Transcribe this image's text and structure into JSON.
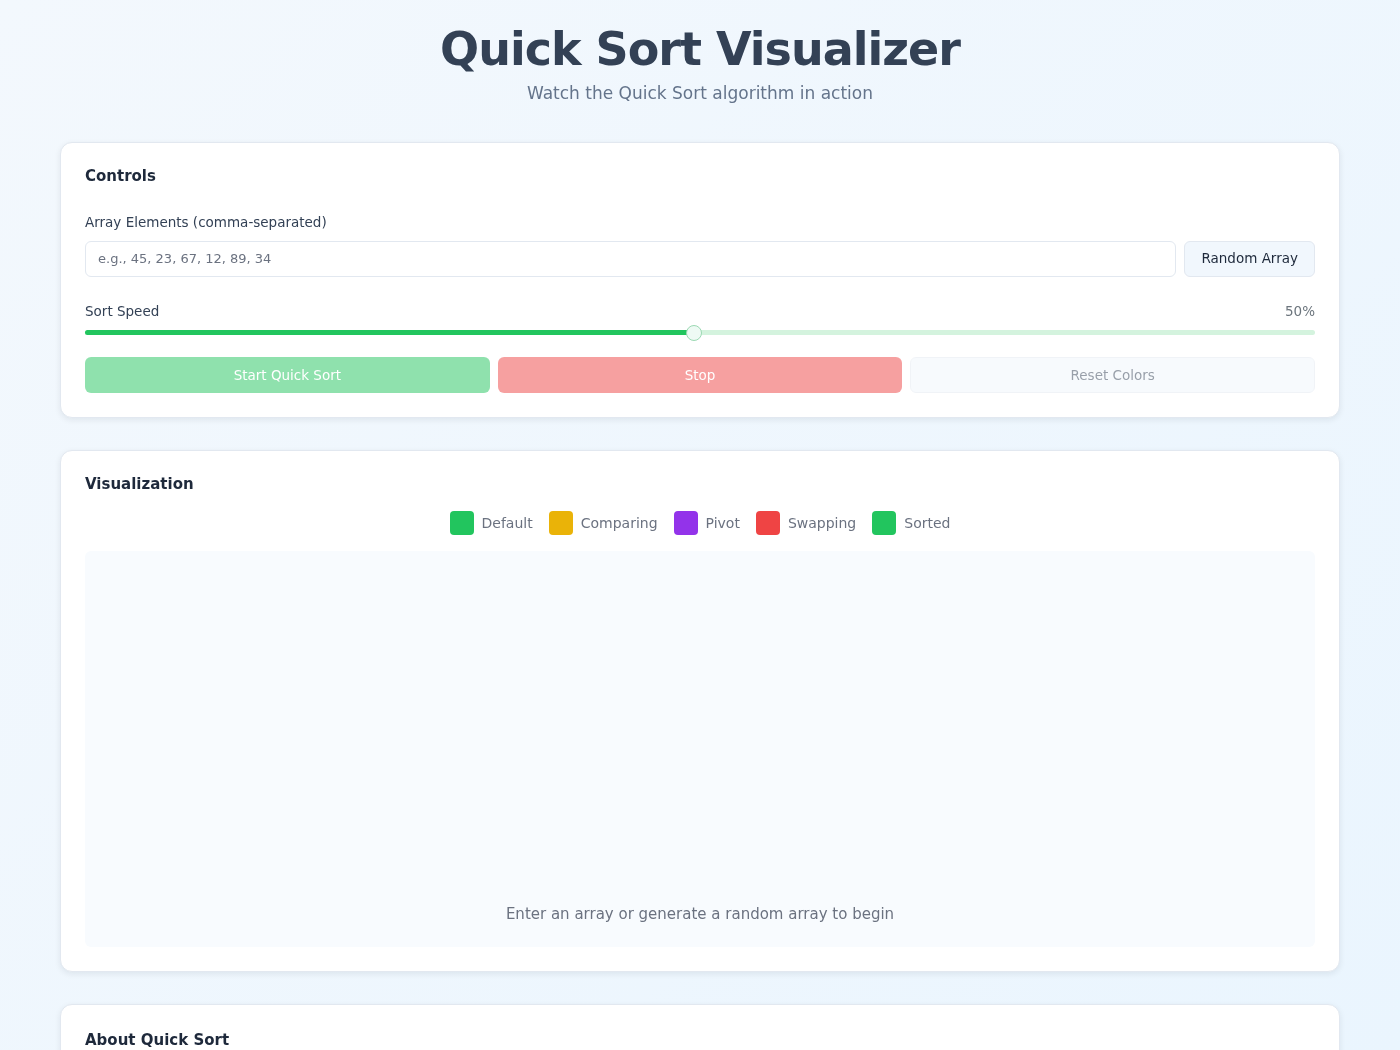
{
  "header": {
    "title": "Quick Sort Visualizer",
    "subtitle": "Watch the Quick Sort algorithm in action"
  },
  "controls": {
    "title": "Controls",
    "array_label": "Array Elements (comma-separated)",
    "array_input": {
      "placeholder": "e.g., 45, 23, 67, 12, 89, 34"
    },
    "random_button": {
      "label": "Random Array",
      "disabled": false
    },
    "speed": {
      "label": "Sort Speed",
      "reading": "50%",
      "level": 0.495
    },
    "buttons": [
      {
        "label": "Start Quick Sort",
        "kind": "start",
        "disabled": true
      },
      {
        "label": "Stop",
        "kind": "stop",
        "disabled": true
      },
      {
        "label": "Reset Colors",
        "kind": "reset",
        "disabled": true
      }
    ]
  },
  "visualization": {
    "title": "Visualization",
    "legend": [
      {
        "label": "Default",
        "color": "#22c55e"
      },
      {
        "label": "Comparing",
        "color": "#eab308"
      },
      {
        "label": "Pivot",
        "color": "#9333ea"
      },
      {
        "label": "Swapping",
        "color": "#ef4444"
      },
      {
        "label": "Sorted",
        "color": "#22c55e"
      }
    ],
    "empty_message": "Enter an array or generate a random array to begin"
  },
  "about": {
    "title": "About Quick Sort"
  }
}
